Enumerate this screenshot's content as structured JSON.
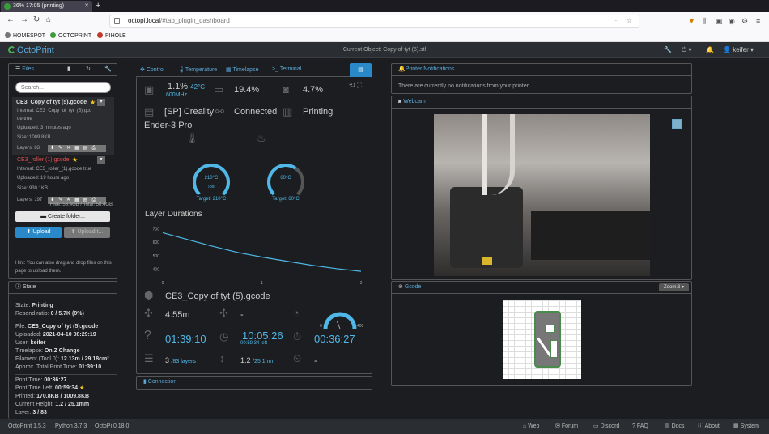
{
  "browser": {
    "tab_title": "36% 17:05 (printing)",
    "url_host": "octopi.local",
    "url_path": "/#tab_plugin_dashboard",
    "bookmarks": [
      "HOMESPOT",
      "OCTOPRINT",
      "PIHOLE"
    ]
  },
  "app": {
    "brand": "OctoPrint",
    "current_object": "Current Object: Copy of tyt (5).stl",
    "user": "keifer"
  },
  "files": {
    "title": "Files",
    "search_placeholder": "Search...",
    "items": [
      {
        "name": "CE3_Copy of tyt (5).gcode",
        "internal": "Internal: CE3_Copy_of_tyt_(5).gco",
        "internal2": "de true",
        "uploaded": "Uploaded: 3 minutes ago",
        "size": "Size: 1009.8KB",
        "layers": "Layers: 83"
      },
      {
        "name": "CE3_roller (1).gcode",
        "internal": "Internal: CE3_roller_(1).gcode true",
        "uploaded": "Uploaded: 19 hours ago",
        "size": "Size: 930.1KB",
        "layers": "Layers: 197"
      }
    ],
    "free": "Free: 53.4GB / Total: 58.4GB",
    "create_folder": "Create folder...",
    "upload": "Upload",
    "upload_sd": "Upload t...",
    "hint": "Hint: You can also drag and drop files on this page to upload them."
  },
  "state": {
    "title": "State",
    "state_label": "State: ",
    "state_value": "Printing",
    "resend_label": "Resend ratio: ",
    "resend_value": "0 / 5.7K (0%)",
    "file_label": "File: ",
    "file_value": "CE3_Copy of tyt (5).gcode",
    "uploaded_label": "Uploaded: ",
    "uploaded_value": "2021-04-10 08:29:19",
    "user_label": "User: ",
    "user_value": "keifer",
    "timelapse_label": "Timelapse: ",
    "timelapse_value": "On Z Change",
    "filament_label": "Filament (Tool 0): ",
    "filament_value": "12.13m / 29.18cm³",
    "approx_label": "Approx. Total Print Time: ",
    "approx_value": "01:39:10",
    "printtime_label": "Print Time: ",
    "printtime_value": "00:36:27",
    "timeleft_label": "Print Time Left: ",
    "timeleft_value": "00:59:34",
    "printed_label": "Printed: ",
    "printed_value": "170.8KB / 1009.8KB",
    "height_label": "Current Height: ",
    "height_value": "1.2 / 25.1mm",
    "layer_label": "Layer: ",
    "layer_value": "3 / 83"
  },
  "tabs": [
    "Control",
    "Temperature",
    "Timelapse",
    "Terminal"
  ],
  "dashboard": {
    "cpu_pct": "1.1%",
    "cpu_temp": "42°C",
    "cpu_freq": "600MHz",
    "mem_pct": "19.4%",
    "disk_pct": "4.7%",
    "printer_name": "[SP] Creality",
    "printer_name2": "Ender-3 Pro",
    "conn_status": "Connected",
    "print_status": "Printing",
    "tool_temp": "210°C",
    "tool_label": "Tool",
    "tool_target": "Target: 210°C",
    "bed_temp": "60°C",
    "bed_target": "Target: 60°C",
    "layer_durations_title": "Layer Durations",
    "file_name": "CE3_Copy of tyt (5).gcode",
    "filament_len": "4.55m",
    "filament_dash": "-",
    "speed_gauge_min": "0",
    "speed_gauge_max": "400",
    "est_total": "01:39:10",
    "time_now": "10:05:26",
    "time_left_small": "00:59:34 left",
    "elapsed": "00:36:27",
    "layer_cur": "3",
    "layer_total": "/83 layers",
    "height_cur": "1.2",
    "height_total": "/25.1mm",
    "timer_dash": "-"
  },
  "connection": {
    "title": "Connection"
  },
  "notifications": {
    "title": "Printer Notifications",
    "text": "There are currently no notifications from your printer."
  },
  "webcam": {
    "title": "Webcam"
  },
  "gcode": {
    "title": "Gcode",
    "zoom": "Zoom:3"
  },
  "footer": {
    "version": "OctoPrint 1.5.3",
    "python": "Python 3.7.3",
    "octopi": "OctoPi 0.18.0",
    "links": [
      "Web",
      "Forum",
      "Discord",
      "FAQ",
      "Docs",
      "About",
      "System"
    ]
  },
  "chart_data": {
    "type": "line",
    "title": "Layer Durations",
    "x": [
      0,
      0.25,
      0.5,
      0.75,
      1,
      1.25,
      1.5,
      1.75,
      2
    ],
    "series": [
      {
        "values": [
          670,
          620,
          570,
          525,
          490,
          460,
          430,
          405,
          385
        ]
      }
    ],
    "xticks": [
      "0",
      "1",
      "2"
    ],
    "yticks": [
      "700",
      "600",
      "500",
      "400"
    ],
    "xlim": [
      0,
      2
    ],
    "ylim": [
      350,
      720
    ],
    "grid": false,
    "color": "#4fb8e8"
  }
}
